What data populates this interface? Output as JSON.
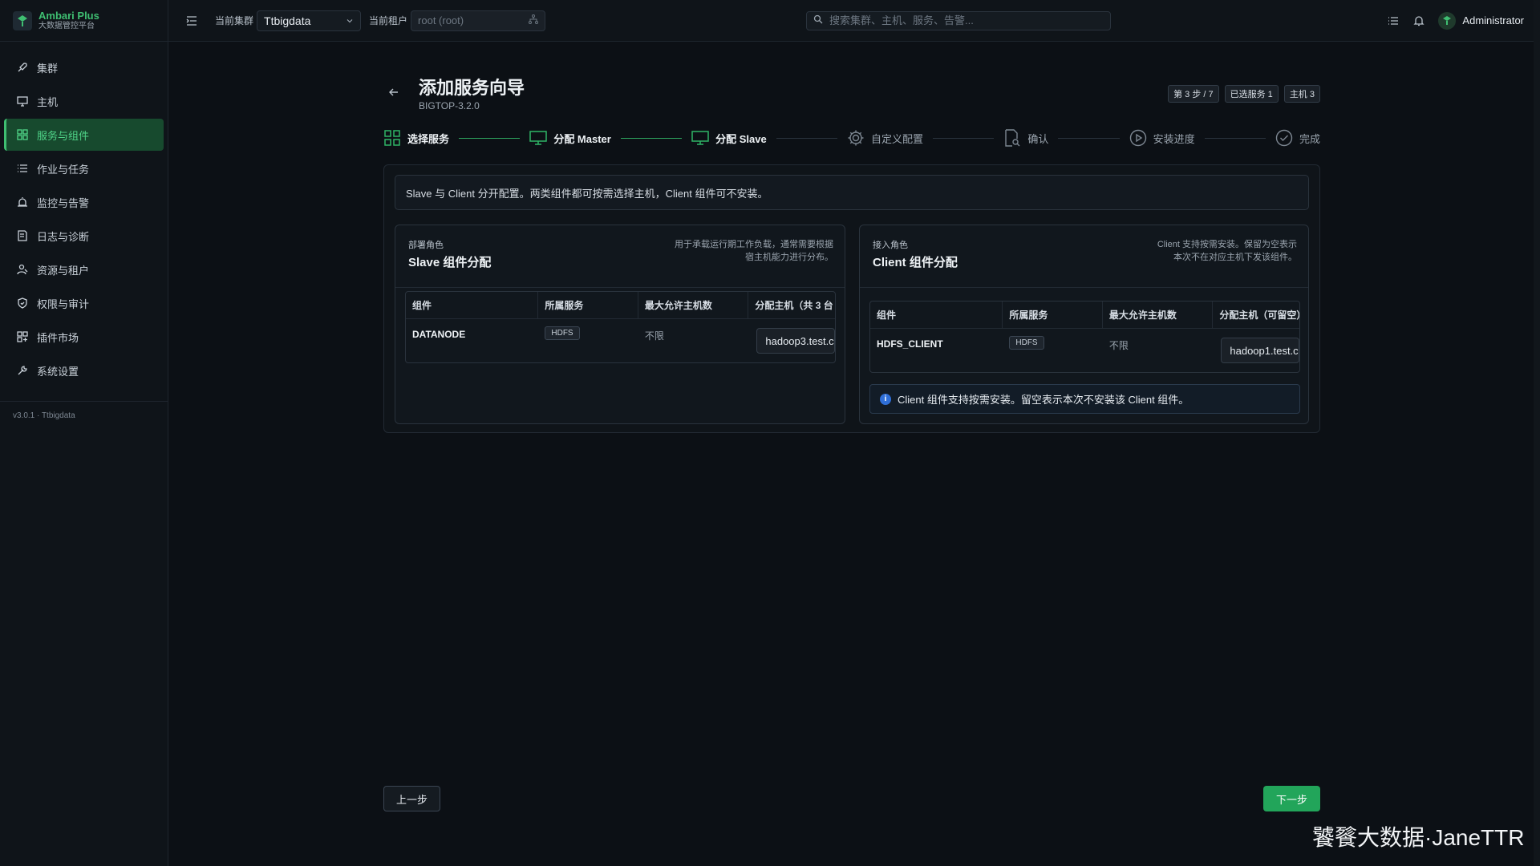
{
  "brand": {
    "name": "Ambari Plus",
    "subtitle": "大数据管控平台"
  },
  "sidebar": {
    "items": [
      {
        "label": "集群",
        "icon": "rocket-icon",
        "active": false
      },
      {
        "label": "主机",
        "icon": "monitor-icon",
        "active": false
      },
      {
        "label": "服务与组件",
        "icon": "grid-icon",
        "active": true
      },
      {
        "label": "作业与任务",
        "icon": "list-icon",
        "active": false
      },
      {
        "label": "监控与告警",
        "icon": "alarm-icon",
        "active": false
      },
      {
        "label": "日志与诊断",
        "icon": "log-icon",
        "active": false
      },
      {
        "label": "资源与租户",
        "icon": "users-icon",
        "active": false
      },
      {
        "label": "权限与审计",
        "icon": "shield-icon",
        "active": false
      },
      {
        "label": "插件市场",
        "icon": "plugin-icon",
        "active": false
      },
      {
        "label": "系统设置",
        "icon": "wrench-icon",
        "active": false
      }
    ],
    "version": "v3.0.1 · Ttbigdata"
  },
  "topbar": {
    "cluster_label": "当前集群",
    "cluster_value": "Ttbigdata",
    "tenant_label": "当前租户",
    "tenant_placeholder": "root (root)",
    "search_placeholder": "搜索集群、主机、服务、告警...",
    "user": "Administrator"
  },
  "wizard": {
    "title": "添加服务向导",
    "stack": "BIGTOP-3.2.0",
    "badges": [
      "第 3 步 / 7",
      "已选服务 1",
      "主机 3"
    ],
    "steps": [
      {
        "label": "选择服务",
        "state": "done"
      },
      {
        "label": "分配 Master",
        "state": "done"
      },
      {
        "label": "分配 Slave",
        "state": "current"
      },
      {
        "label": "自定义配置",
        "state": "pending"
      },
      {
        "label": "确认",
        "state": "pending"
      },
      {
        "label": "安装进度",
        "state": "pending"
      },
      {
        "label": "完成",
        "state": "pending"
      }
    ],
    "info": "Slave 与 Client 分开配置。两类组件都可按需选择主机，Client 组件可不安装。"
  },
  "slave_card": {
    "kicker": "部署角色",
    "title": "Slave 组件分配",
    "desc": "用于承载运行期工作负载，通常需要根据宿主机能力进行分布。",
    "headers": [
      "组件",
      "所属服务",
      "最大允许主机数",
      "分配主机（共 3 台"
    ],
    "rows": [
      {
        "component": "DATANODE",
        "service": "HDFS",
        "max": "不限",
        "host": "hadoop3.test.c"
      }
    ]
  },
  "client_card": {
    "kicker": "接入角色",
    "title": "Client 组件分配",
    "desc": "Client 支持按需安装。保留为空表示本次不在对应主机下发该组件。",
    "headers": [
      "组件",
      "所属服务",
      "最大允许主机数",
      "分配主机（可留空）"
    ],
    "rows": [
      {
        "component": "HDFS_CLIENT",
        "service": "HDFS",
        "max": "不限",
        "host": "hadoop1.test.c"
      }
    ],
    "note": "Client 组件支持按需安装。留空表示本次不安装该 Client 组件。"
  },
  "footer": {
    "prev": "上一步",
    "next": "下一步"
  },
  "watermark": "饕餮大数据·JaneTTR",
  "colors": {
    "accent": "#22a55a",
    "active_bg": "#174a2e",
    "background": "#0c1015"
  }
}
